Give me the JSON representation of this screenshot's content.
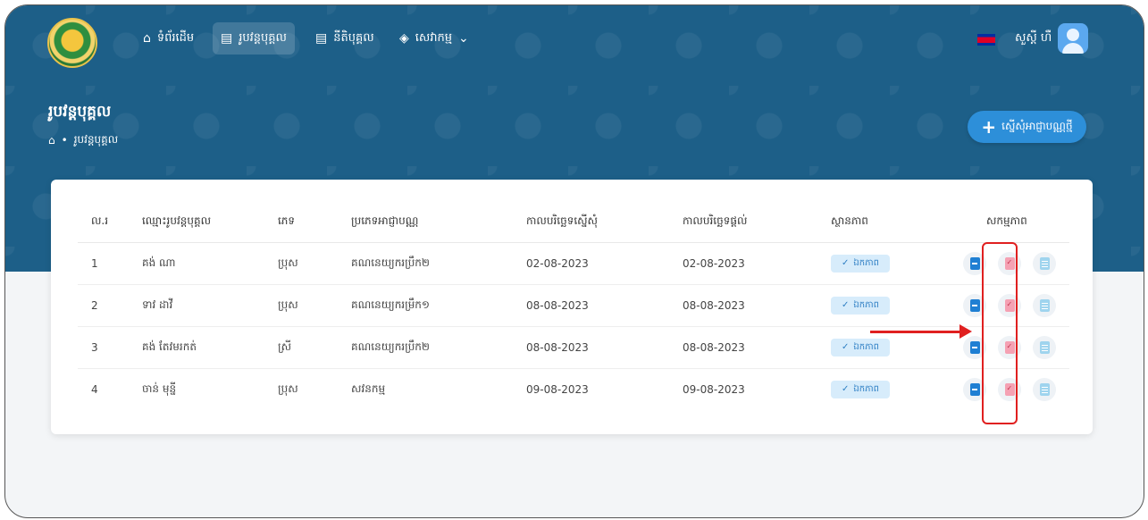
{
  "nav": {
    "items": [
      {
        "label": "ទំព័រដើម",
        "icon": "home-icon"
      },
      {
        "label": "រូបវន្តបុគ្គល",
        "icon": "document-icon"
      },
      {
        "label": "នីតិបុគ្គល",
        "icon": "document-icon"
      },
      {
        "label": "សេវាកម្ម",
        "icon": "layers-icon"
      }
    ],
    "user_name": "សួស្តី ហឺ"
  },
  "page": {
    "title": "រូបវន្តបុគ្គល",
    "breadcrumb_current": "រូបវន្តបុគ្គល",
    "add_button_label": "ស្នើសុំអាជ្ញាបណ្ណថ្មី"
  },
  "table": {
    "headers": [
      "ល.រ",
      "ឈ្មោះរូបវន្តបុគ្គល",
      "ភេទ",
      "ប្រភេទអាជ្ញាបណ្ណ",
      "កាលបរិច្ឆេទស្នើសុំ",
      "កាលបរិច្ឆេទផ្តល់",
      "ស្ថានភាព",
      "សកម្មភាព"
    ],
    "rows": [
      {
        "no": "1",
        "name": "គង់ ណា",
        "gender": "ប្រុស",
        "type": "គណនេយ្យករប្រឹក២",
        "requested": "02-08-2023",
        "issued": "02-08-2023",
        "status": "ឯកភាព"
      },
      {
        "no": "2",
        "name": "ទាវ ដាវី",
        "gender": "ប្រុស",
        "type": "គណនេយ្យករម្រឹក១",
        "requested": "08-08-2023",
        "issued": "08-08-2023",
        "status": "ឯកភាព"
      },
      {
        "no": "3",
        "name": "គង់ តែវមរកត់",
        "gender": "ស្រី",
        "type": "គណនេយ្យករប្រឹក២",
        "requested": "08-08-2023",
        "issued": "08-08-2023",
        "status": "ឯកភាព"
      },
      {
        "no": "4",
        "name": "ចាន់ មុន្នី",
        "gender": "ប្រុស",
        "type": "សវនកម្ម",
        "requested": "09-08-2023",
        "issued": "09-08-2023",
        "status": "ឯកភាព"
      }
    ]
  },
  "colors": {
    "banner": "#1d5f88",
    "accent": "#2d8fd9",
    "highlight": "#e02020"
  }
}
